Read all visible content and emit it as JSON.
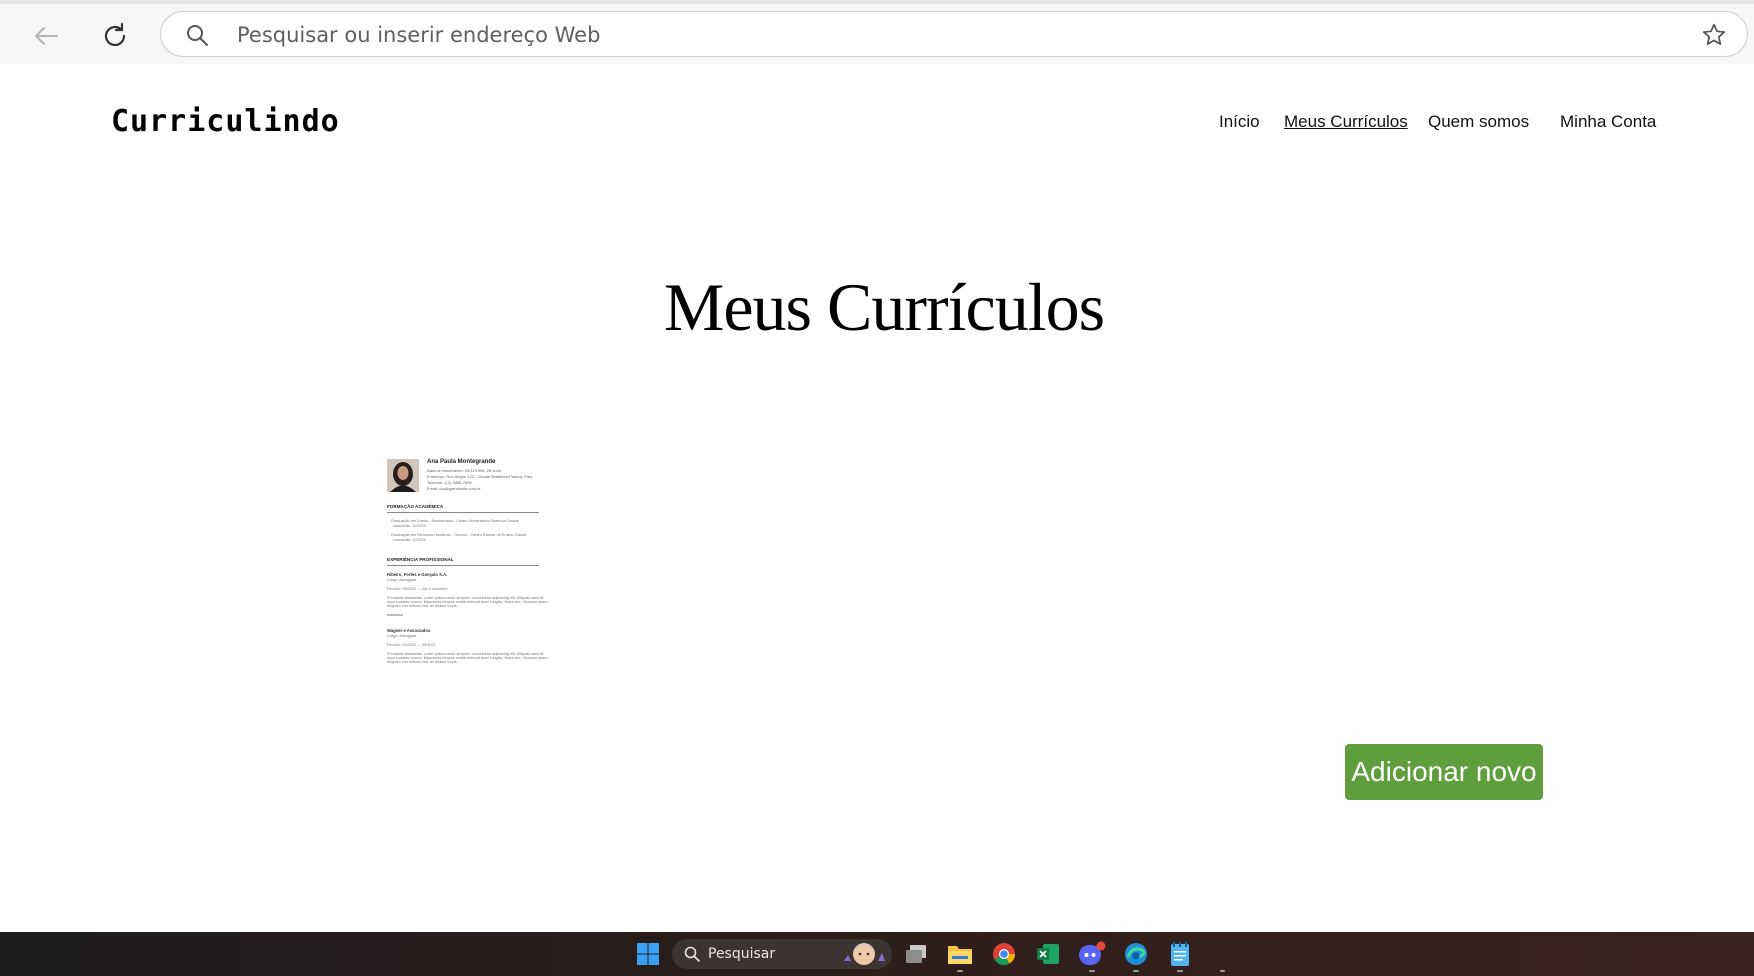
{
  "browser": {
    "address_placeholder": "Pesquisar ou inserir endereço Web",
    "icons": [
      "back-arrow-icon",
      "reload-icon",
      "search-icon",
      "star-icon"
    ]
  },
  "site": {
    "logo": "Curriculindo",
    "nav": [
      {
        "label": "Início",
        "active": false
      },
      {
        "label": "Meus Currículos",
        "active": true
      },
      {
        "label": "Quem somos",
        "active": false
      },
      {
        "label": "Minha Conta",
        "active": false
      }
    ]
  },
  "main": {
    "title": "Meus Currículos",
    "add_button": "Adicionar novo",
    "resume": {
      "name": "Ana Paula Montegrande",
      "details": [
        "Data de nascimento: 20/11/1996, 28 anos",
        "Endereço: Rua Alegre 123 - Cidade Brasileira Paraná, País",
        "Telefone: (12) 3456-7890",
        "Email: ola@grandesite.com.br"
      ],
      "section_education": "FORMAÇÃO ACADÊMICA",
      "education": [
        "Graduação em Direito - Bacharelado - Centro Universitário Fazenda Cidade",
        "conclusão: 12/2020",
        "Graduação em Recursos Humanos - Técnico - Centro Escolar de Ensino Cidade",
        "conclusão: 12/2020"
      ],
      "section_experience": "EXPERIÊNCIA PROFISSIONAL",
      "jobs": [
        {
          "company": "Ribeiro, Fortes e Gonçalo S.A.",
          "role": "Cargo: Advogada",
          "period": "Período: 06/2021 — Até o momento",
          "desc": [
            "Principais atividades: Lorem ipsum dolor sit amet, consectetur adipiscing elit. Aliquam arcu et",
            "risus sodales viverra. Maecenas tempus mollis dolor sit amet fringilla. Nulla nec. Vivamus quam.",
            "Aliquam non ultrices nisl, ac dictum turpis."
          ]
        },
        {
          "company": "Wagner e Associados",
          "role": "Cargo: Advogada",
          "period": "Período: 02/2021 — 05/2021",
          "desc": [
            "Principais atividades: Lorem ipsum dolor sit amet, consectetur adipiscing elit. Aliquam arcu et",
            "risus sodales viverra. Maecenas tempus mollis dolor sit amet fringilla. Nulla nec. Vivamus quam.",
            "Aliquam non ultrices nisl, ac dictum turpis."
          ]
        }
      ]
    }
  },
  "taskbar": {
    "search_label": "Pesquisar",
    "apps": [
      "windows-start-icon",
      "task-view-icon",
      "file-explorer-icon",
      "chrome-icon",
      "excel-icon",
      "discord-icon",
      "edge-icon",
      "notepad-icon"
    ]
  },
  "colors": {
    "accent_green": "#5f9e3c",
    "taskbar": "#2a1d1c"
  }
}
